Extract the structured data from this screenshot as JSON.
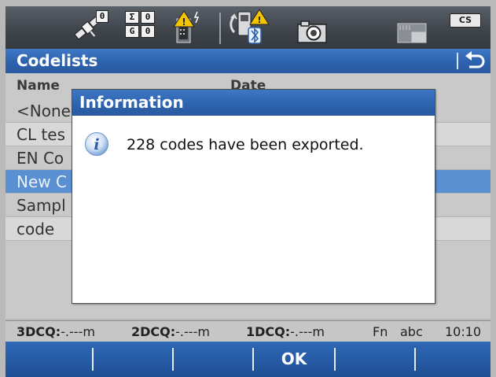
{
  "status_bar": {
    "sat_count": "0",
    "sum_top": "0",
    "sum_bottom": "0",
    "sum_top_label": "Σ",
    "sum_bottom_label": "G",
    "cs_label": "CS"
  },
  "title": {
    "text": "Codelists"
  },
  "list": {
    "columns": [
      "Name",
      "Date"
    ],
    "rows": [
      {
        "name": "<None",
        "selected": false
      },
      {
        "name": "CL tes",
        "selected": false
      },
      {
        "name": "EN Co",
        "selected": false
      },
      {
        "name": "New C",
        "selected": true
      },
      {
        "name": "Sampl",
        "selected": false
      },
      {
        "name": "code",
        "selected": false
      }
    ]
  },
  "footer": {
    "q3_label": "3DCQ:",
    "q3_value": "-.---m",
    "q2_label": "2DCQ:",
    "q2_value": "-.---m",
    "q1_label": "1DCQ:",
    "q1_value": "-.---m",
    "fn": "Fn",
    "input_mode": "abc",
    "time": "10:10"
  },
  "softkeys": {
    "ok_label": "OK"
  },
  "dialog": {
    "title": "Information",
    "message": "228 codes have been exported."
  },
  "colors": {
    "title_blue": "#2d62ad",
    "selected_row": "#5a8fd2",
    "status_bar_dark": "#3e434a",
    "list_background": "#c9c9c9"
  }
}
